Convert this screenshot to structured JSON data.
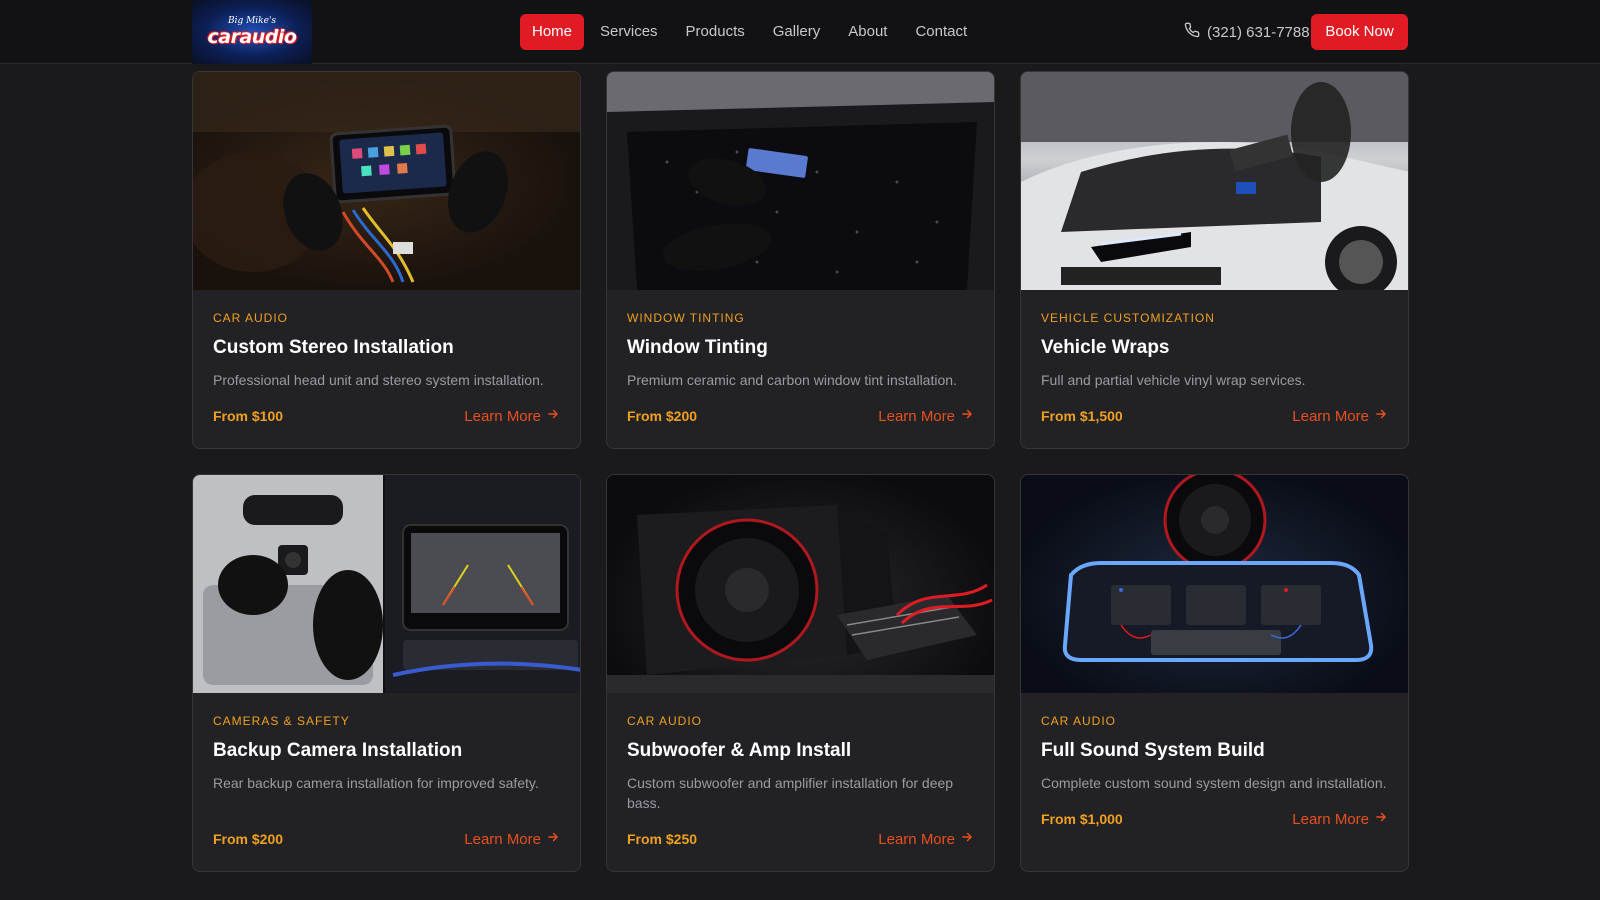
{
  "header": {
    "logo": {
      "top_text": "Big Mike's",
      "main_text": "caraudio"
    },
    "nav": [
      {
        "label": "Home",
        "active": true
      },
      {
        "label": "Services",
        "active": false
      },
      {
        "label": "Products",
        "active": false
      },
      {
        "label": "Gallery",
        "active": false
      },
      {
        "label": "About",
        "active": false
      },
      {
        "label": "Contact",
        "active": false
      }
    ],
    "phone": "(321) 631-7788",
    "book_label": "Book Now"
  },
  "colors": {
    "accent_red": "#e01b24",
    "category_orange": "#f0a020",
    "link_orange": "#e8501e",
    "background": "#1a1a1c"
  },
  "cards": [
    {
      "image_icon": "stereo-install-image",
      "category": "CAR AUDIO",
      "title": "Custom Stereo Installation",
      "description": "Professional head unit and stereo system installation.",
      "price": "From $100",
      "link": "Learn More"
    },
    {
      "image_icon": "window-tint-image",
      "category": "WINDOW TINTING",
      "title": "Window Tinting",
      "description": "Premium ceramic and carbon window tint installation.",
      "price": "From $200",
      "link": "Learn More"
    },
    {
      "image_icon": "vehicle-wrap-image",
      "category": "VEHICLE CUSTOMIZATION",
      "title": "Vehicle Wraps",
      "description": "Full and partial vehicle vinyl wrap services.",
      "price": "From $1,500",
      "link": "Learn More"
    },
    {
      "image_icon": "backup-camera-image",
      "category": "CAMERAS & SAFETY",
      "title": "Backup Camera Installation",
      "description": "Rear backup camera installation for improved safety.",
      "price": "From $200",
      "link": "Learn More"
    },
    {
      "image_icon": "subwoofer-amp-image",
      "category": "CAR AUDIO",
      "title": "Subwoofer & Amp Install",
      "description": "Custom subwoofer and amplifier installation for deep bass.",
      "price": "From $250",
      "link": "Learn More"
    },
    {
      "image_icon": "sound-system-image",
      "category": "CAR AUDIO",
      "title": "Full Sound System Build",
      "description": "Complete custom sound system design and installation.",
      "price": "From $1,000",
      "link": "Learn More"
    }
  ]
}
